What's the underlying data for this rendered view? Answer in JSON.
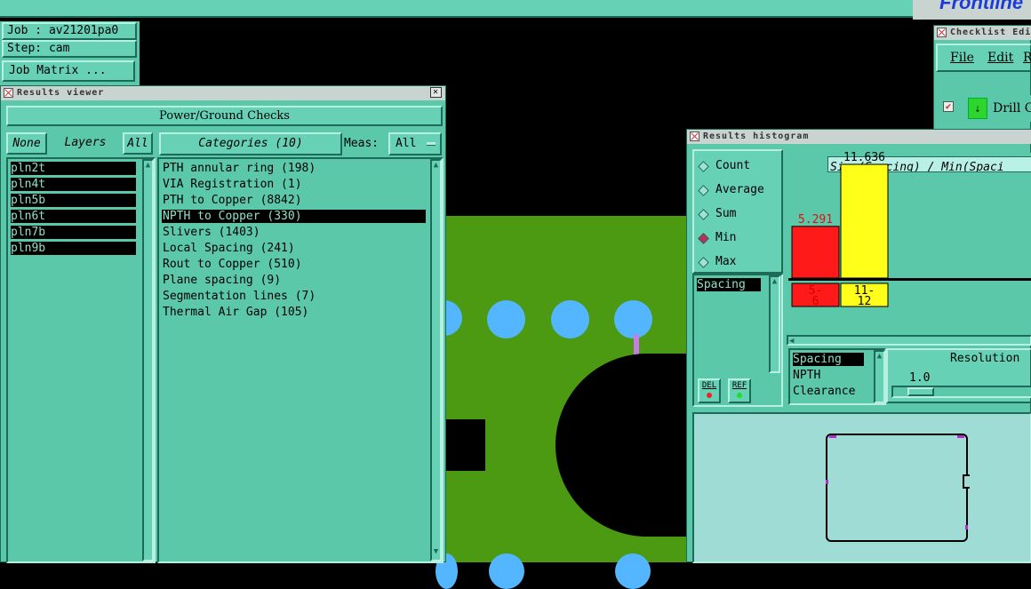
{
  "job_info": {
    "job": "Job : av21201pa0",
    "step": "Step: cam",
    "matrix_button": "Job Matrix ..."
  },
  "app_logo": "Frontline",
  "results_viewer": {
    "title": "Results viewer",
    "header": "Power/Ground Checks",
    "none_btn": "None",
    "layers_label": "Layers",
    "all_btn": "All",
    "layers": [
      "pln2t",
      "pln4t",
      "pln5b",
      "pln6t",
      "pln7b",
      "pln9b"
    ],
    "categories_label": "Categories (10)",
    "meas_label": "Meas:",
    "meas_value": "All",
    "categories": [
      "PTH annular ring (198)",
      "VIA Registration (1)",
      "PTH to Copper (8842)",
      "NPTH to Copper (330)",
      "Slivers (1403)",
      "Local Spacing (241)",
      "Rout to Copper (510)",
      "Plane spacing (9)",
      "Segmentation lines (7)",
      "Thermal Air Gap (105)"
    ],
    "selected_category": 3
  },
  "checklist": {
    "title": "Checklist Edi",
    "menu": [
      "File",
      "Edit",
      "R"
    ],
    "item": "Drill C"
  },
  "histogram": {
    "title": "Results histogram",
    "modes": [
      "Count",
      "Average",
      "Sum",
      "Min",
      "Max"
    ],
    "selected_mode": "Min",
    "list_item": "Spacing",
    "del_btn": "DEL",
    "ref_btn": "REF",
    "chart_title": "Size(Spacing) / Min(Spaci",
    "resolution_label": "Resolution",
    "resolution_value": "1.0",
    "measure_list": [
      "Spacing",
      "NPTH",
      "Clearance"
    ],
    "colors": {
      "bar1": "#ff1a1a",
      "bar2": "#ffff1a"
    }
  },
  "chart_data": {
    "type": "bar",
    "title": "Size(Spacing) / Min(Spaci",
    "categories": [
      "5-6",
      "11-12"
    ],
    "values": [
      5.291,
      11.636
    ],
    "value_labels": [
      "5.291",
      "11.636"
    ],
    "category_labels": [
      [
        "5-",
        "6"
      ],
      [
        "11-",
        "12"
      ]
    ]
  }
}
